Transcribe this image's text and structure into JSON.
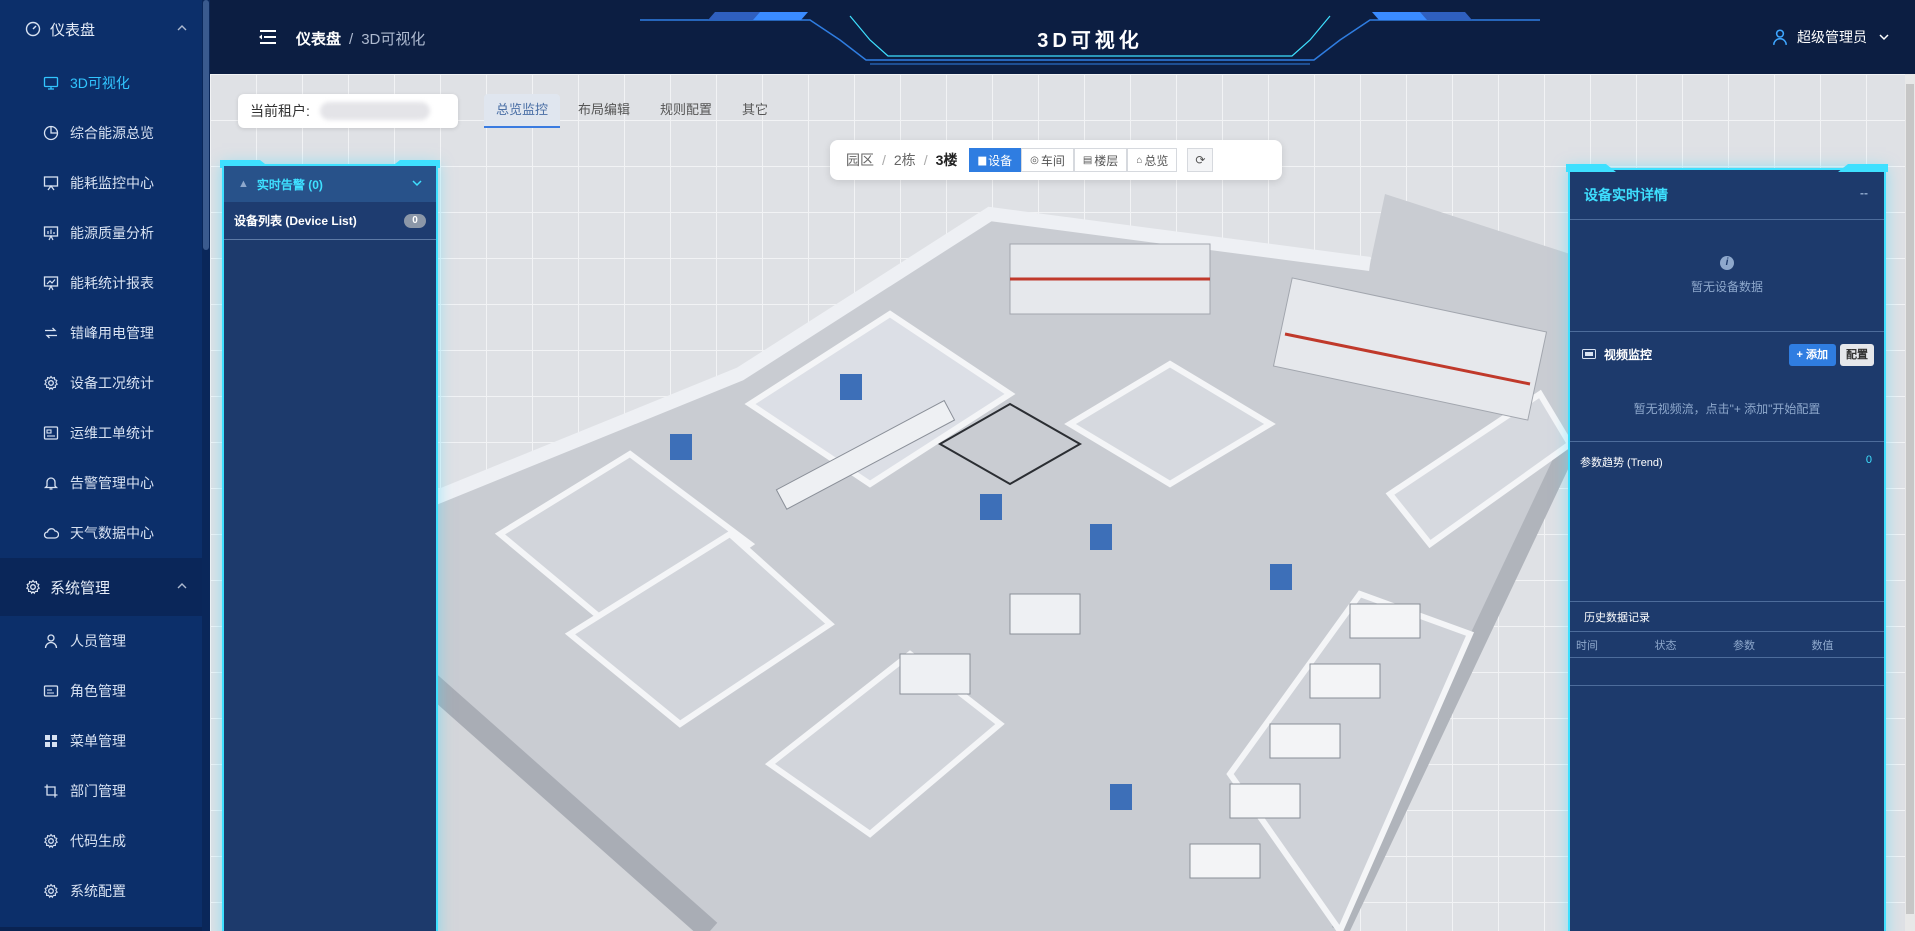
{
  "sidebar": {
    "dashboard_group": "仪表盘",
    "dashboard_items": [
      {
        "label": "3D可视化",
        "icon": "monitor-icon"
      },
      {
        "label": "综合能源总览",
        "icon": "pie-chart-icon"
      },
      {
        "label": "能耗监控中心",
        "icon": "presentation-board-icon"
      },
      {
        "label": "能源质量分析",
        "icon": "bar-board-icon"
      },
      {
        "label": "能耗统计报表",
        "icon": "report-icon"
      },
      {
        "label": "错峰用电管理",
        "icon": "switch-icon"
      },
      {
        "label": "设备工况统计",
        "icon": "gear-icon"
      },
      {
        "label": "运维工单统计",
        "icon": "image-icon"
      },
      {
        "label": "告警管理中心",
        "icon": "bell-icon"
      },
      {
        "label": "天气数据中心",
        "icon": "cloud-icon"
      }
    ],
    "system_group": "系统管理",
    "system_items": [
      {
        "label": "人员管理",
        "icon": "user-icon"
      },
      {
        "label": "角色管理",
        "icon": "id-card-icon"
      },
      {
        "label": "菜单管理",
        "icon": "grid-icon"
      },
      {
        "label": "部门管理",
        "icon": "crop-icon"
      },
      {
        "label": "代码生成",
        "icon": "gear-icon"
      },
      {
        "label": "系统配置",
        "icon": "gear-icon"
      }
    ]
  },
  "header": {
    "breadcrumb_root": "仪表盘",
    "breadcrumb_sep": "/",
    "breadcrumb_current": "3D可视化",
    "title": "3D可视化",
    "user_name": "超级管理员"
  },
  "toolbar": {
    "tenant_label": "当前租户:",
    "tabs": [
      "总览监控",
      "布局编辑",
      "规则配置",
      "其它"
    ],
    "active_tab": "总览监控"
  },
  "location": {
    "park": "园区",
    "sep": "/",
    "building": "2栋",
    "floor": "3楼",
    "views": [
      {
        "label": "设备",
        "glyph": "▆"
      },
      {
        "label": "车间",
        "glyph": "◎"
      },
      {
        "label": "楼层",
        "glyph": "▤"
      },
      {
        "label": "总览",
        "glyph": "⌂"
      }
    ],
    "active_view": "设备",
    "refresh_glyph": "⟳"
  },
  "left_panel": {
    "alarm_title": "实时告警 (0)",
    "alarm_glyph": "▲",
    "device_list_title": "设备列表 (Device List)",
    "device_count": "0"
  },
  "right_panel": {
    "title": "设备实时详情",
    "title_placeholder": "--",
    "info_glyph": "i",
    "no_device_data": "暂无设备数据",
    "video_title": "视频监控",
    "add_button": "+ 添加",
    "config_button": "配置",
    "no_video": "暂无视频流，点击\"+ 添加\"开始配置",
    "trend_title": "参数趋势 (Trend)",
    "trend_count": "0",
    "history_title": "历史数据记录",
    "history_columns": [
      "时间",
      "状态",
      "参数",
      "数值"
    ]
  },
  "colors": {
    "sidebar_bg": "#0c2f6a",
    "header_bg": "#0c1e42",
    "accent_cyan": "#3ee0ff",
    "active_blue": "#2f7de1",
    "panel_bg": "#1d3a6c"
  }
}
